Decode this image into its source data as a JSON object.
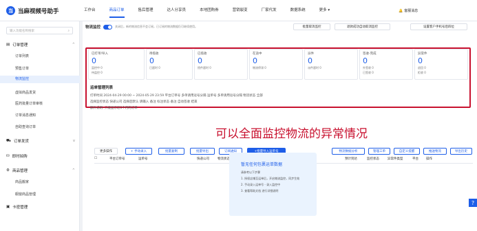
{
  "app": {
    "name": "当麻视频号助手",
    "logo_char": "当"
  },
  "nav": [
    "工作台",
    "商品订单",
    "售后管理",
    "达人分享员",
    "本地团购券",
    "营销裂变",
    "厂家代发",
    "数据系统",
    "更多 ▾"
  ],
  "notify": "客服消息",
  "sidebar": {
    "search_placeholder": "输入功能名称搜索",
    "groups": [
      {
        "label": "订单管理",
        "items": [
          "订单列表",
          "预售订单",
          "物流监控",
          "虚拟商品发货",
          "医药批量订单审核",
          "订单消息通知",
          "自助查询订单"
        ]
      },
      {
        "label": "订单发货"
      },
      {
        "label": "商品管理"
      },
      {
        "label": "卡密管理"
      }
    ],
    "extra": [
      "即时拍购",
      "商品搬家",
      "橱窗商品管理"
    ]
  },
  "header": {
    "title": "物流监控",
    "hint": "关闭后，新的物流信息不会订阅，已订阅的物流数据仍可继续使用。"
  },
  "top_buttons": [
    "批量取消监控",
    "退款成功自动取消监控",
    "设置客户手机号后四位"
  ],
  "stats": [
    {
      "title": "已打单/导入",
      "value": "0",
      "sub": "监控中 0",
      "sub2": "待监控 0"
    },
    {
      "title": "待揽收",
      "value": "0",
      "sub": "已超时 0"
    },
    {
      "title": "已揽收",
      "value": "0",
      "sub": "揽件超时 0"
    },
    {
      "title": "在途中",
      "value": "0",
      "sub": "物流停滞 0"
    },
    {
      "title": "派件",
      "value": "0",
      "sub": "派件超时 0"
    },
    {
      "title": "签收-完成",
      "value": "0",
      "sub": "外签收 0",
      "sub2": "已签收 0"
    },
    {
      "title": "异常件",
      "value": "0",
      "sub": "退回 0",
      "sub2": "拒收 0"
    }
  ],
  "sec_title": "运单管理列表",
  "filters": {
    "row1": "打单时间  2024-04-29 00:00 ~ 2024-05-29 23:59   平台订单号   多单请用逗号分隔   运单号   多单请用逗号分隔   物流状态 全部",
    "row2": "选择监控状态      快递公司      选择后默认   请输入   备注   标注状态   备注  自动签收   结束",
    "row3": "额外说明: 只能显示近3个月的订单"
  },
  "actions": [
    "更多操作",
    "+ 手动录入",
    "批量复制",
    "批量导出",
    "订阅通知",
    "+批量导入运单号",
    "物流数据分析",
    "管理工单",
    "自定义提醒",
    "推送物流",
    "导出历史"
  ],
  "table_headers": [
    "",
    "",
    "平台订单号",
    "运单号",
    "快递公司",
    "物流状态",
    "揽收时间",
    "最新轨迹",
    "预计到达",
    "监控状态",
    "异常件类型",
    "平台",
    "操作"
  ],
  "empty": {
    "title": "暂无任何包裹运单数据",
    "lines": [
      "请参考以下步骤",
      "1. 授权店铺至运单后，开启物流监控，同步生效",
      "2. 手动录入运单号 - 录入监控中",
      "3. 查看帮助文档 进行详细说明"
    ]
  },
  "overlay": "可以全面监控物流的异常情况"
}
